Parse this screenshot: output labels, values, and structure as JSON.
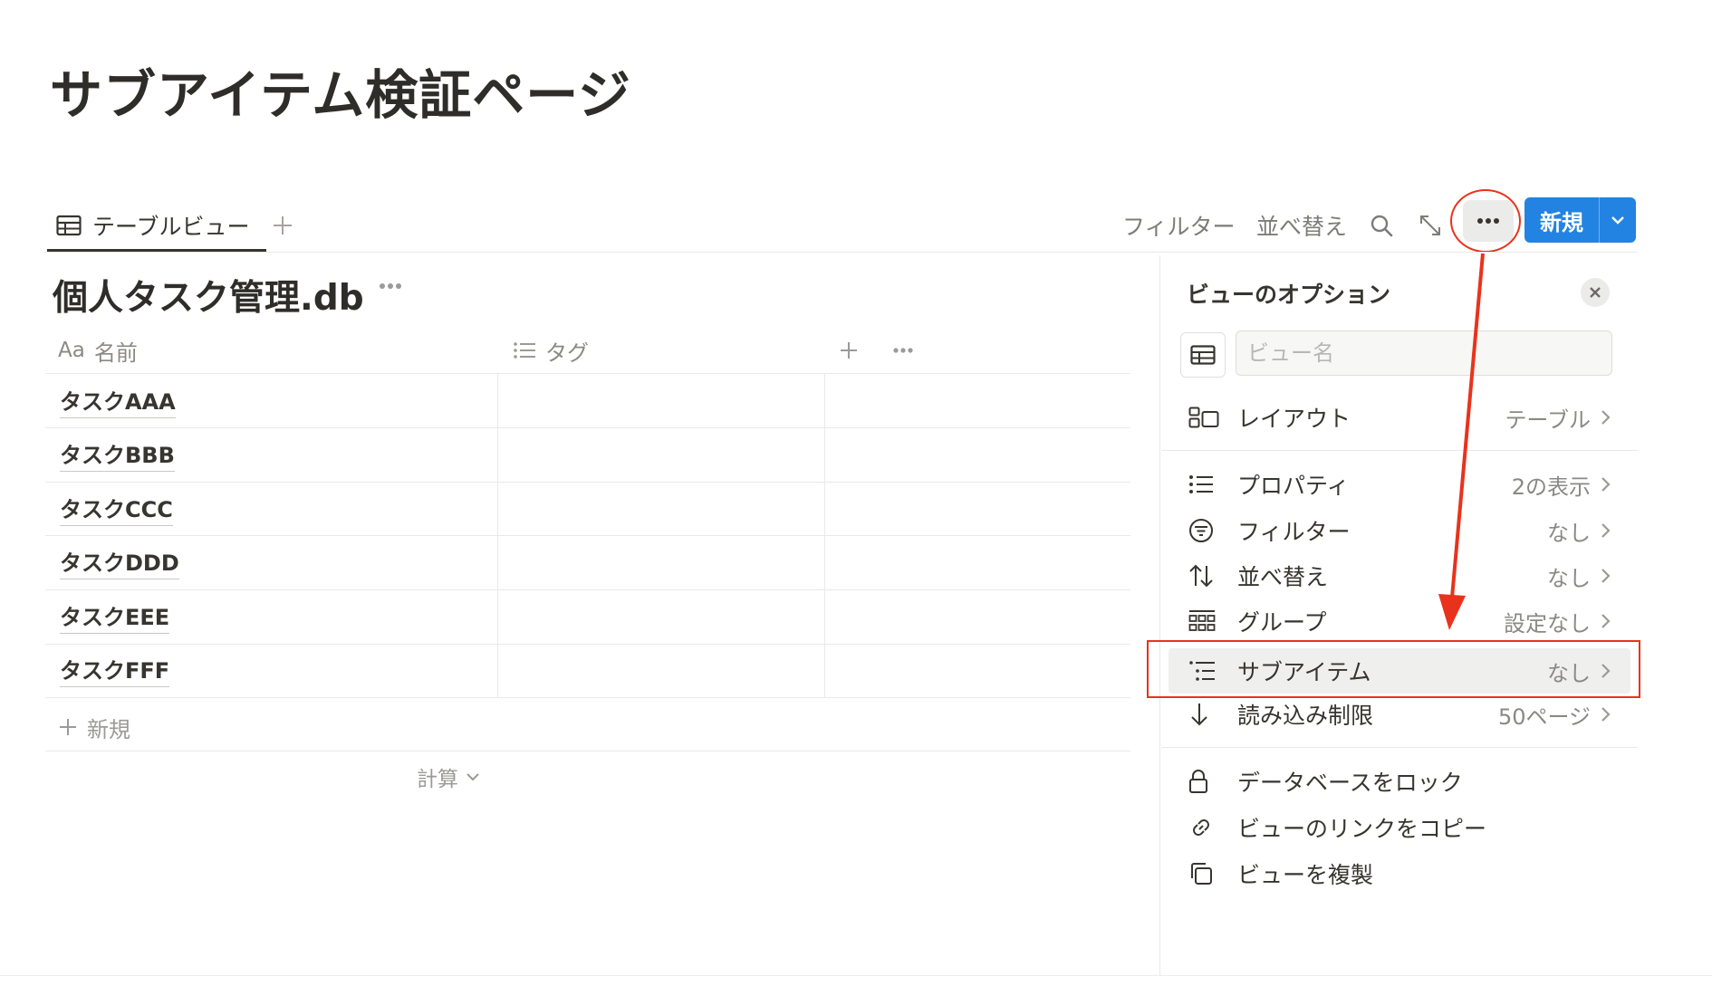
{
  "page": {
    "title": "サブアイテム検証ページ"
  },
  "tabs": [
    {
      "label": "テーブルビュー",
      "active": true
    }
  ],
  "toolbar": {
    "filter_label": "フィルター",
    "sort_label": "並べ替え",
    "new_label": "新規",
    "new_button_color": "#2383e2"
  },
  "database": {
    "title": "個人タスク管理.db",
    "columns": [
      {
        "prefix": "Aa",
        "label": "名前",
        "icon": "text-type-icon"
      },
      {
        "label": "タグ",
        "icon": "list-icon"
      }
    ],
    "rows": [
      {
        "name": "タスクAAA"
      },
      {
        "name": "タスクBBB"
      },
      {
        "name": "タスクCCC"
      },
      {
        "name": "タスクDDD"
      },
      {
        "name": "タスクEEE"
      },
      {
        "name": "タスクFFF"
      }
    ],
    "add_row_label": "新規",
    "calc_label": "計算"
  },
  "panel": {
    "title": "ビューのオプション",
    "view_name_placeholder": "ビュー名",
    "layout": {
      "label": "レイアウト",
      "value": "テーブル",
      "icon": "layout-icon"
    },
    "settings": [
      {
        "label": "プロパティ",
        "value": "2の表示",
        "icon": "properties-icon"
      },
      {
        "label": "フィルター",
        "value": "なし",
        "icon": "filter-icon"
      },
      {
        "label": "並べ替え",
        "value": "なし",
        "icon": "sort-icon"
      },
      {
        "label": "グループ",
        "value": "設定なし",
        "icon": "group-icon"
      },
      {
        "label": "サブアイテム",
        "value": "なし",
        "icon": "sub-items-icon",
        "highlighted": true
      },
      {
        "label": "読み込み制限",
        "value": "50ページ",
        "icon": "load-limit-icon"
      }
    ],
    "actions": [
      {
        "label": "データベースをロック",
        "icon": "lock-icon"
      },
      {
        "label": "ビューのリンクをコピー",
        "icon": "link-icon"
      },
      {
        "label": "ビューを複製",
        "icon": "duplicate-icon"
      }
    ]
  },
  "annotations": {
    "color": "#e8331c"
  }
}
